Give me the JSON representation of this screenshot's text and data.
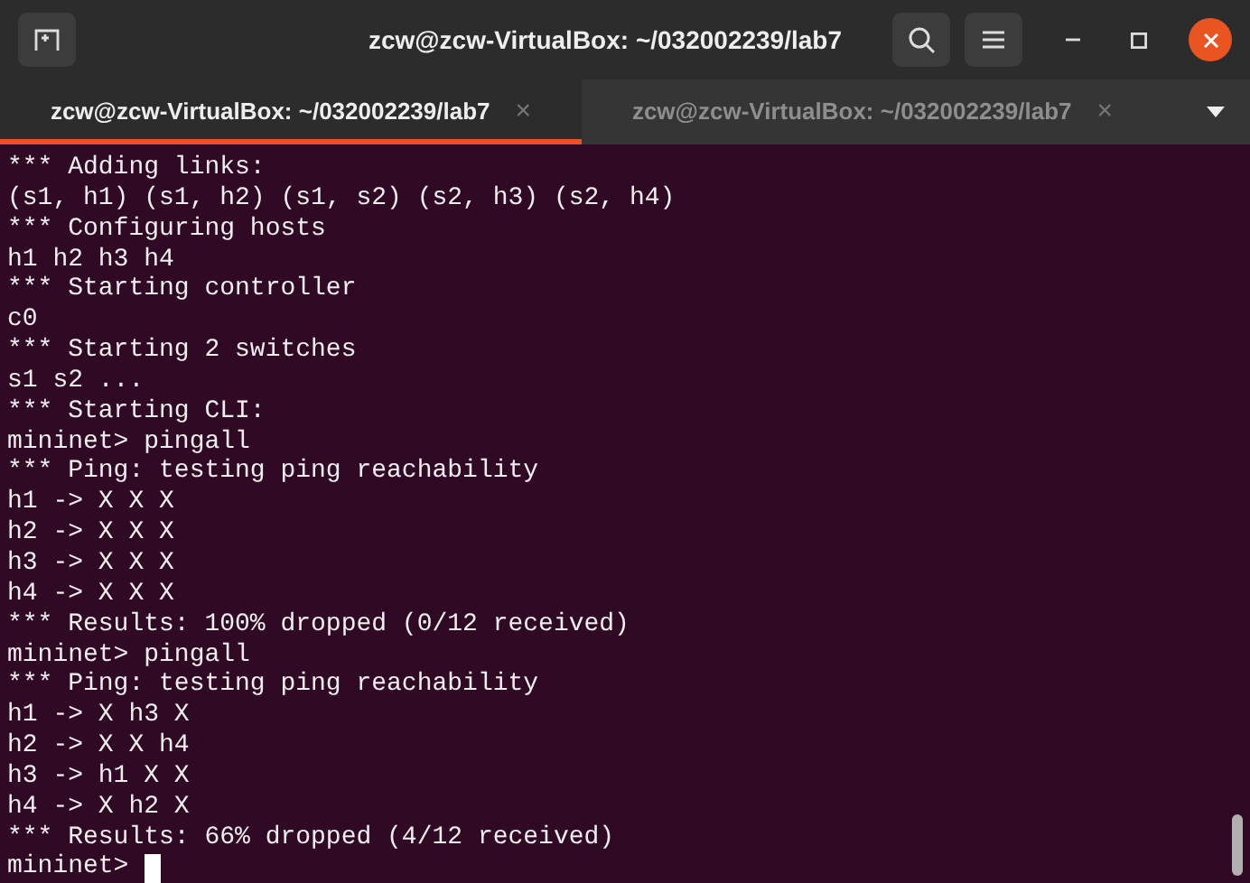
{
  "window": {
    "title": "zcw@zcw-VirtualBox: ~/032002239/lab7"
  },
  "tabs": [
    {
      "label": "zcw@zcw-VirtualBox: ~/032002239/lab7",
      "close": "×",
      "selected": true
    },
    {
      "label": "zcw@zcw-VirtualBox: ~/032002239/lab7",
      "close": "×",
      "selected": false
    }
  ],
  "terminal": {
    "lines": [
      "*** Adding links:",
      "(s1, h1) (s1, h2) (s1, s2) (s2, h3) (s2, h4)",
      "*** Configuring hosts",
      "h1 h2 h3 h4",
      "*** Starting controller",
      "c0",
      "*** Starting 2 switches",
      "s1 s2 ...",
      "*** Starting CLI:",
      "mininet> pingall",
      "*** Ping: testing ping reachability",
      "h1 -> X X X",
      "h2 -> X X X",
      "h3 -> X X X",
      "h4 -> X X X",
      "*** Results: 100% dropped (0/12 received)",
      "mininet> pingall",
      "*** Ping: testing ping reachability",
      "h1 -> X h3 X",
      "h2 -> X X h4",
      "h3 -> h1 X X",
      "h4 -> X h2 X",
      "*** Results: 66% dropped (4/12 received)"
    ],
    "prompt": "mininet>"
  }
}
